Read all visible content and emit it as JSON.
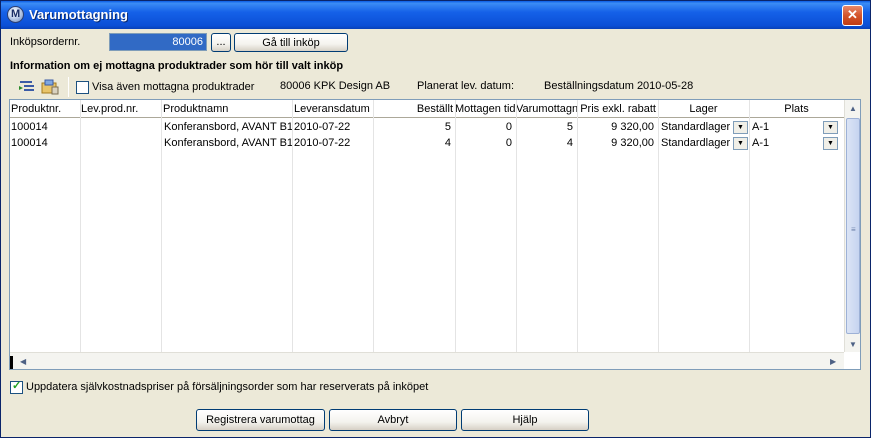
{
  "window": {
    "title": "Varumottagning",
    "close": "✕"
  },
  "po": {
    "label": "Inköpsordernr.",
    "value": "80006",
    "browse_label": "...",
    "goto_label": "Gå till inköp"
  },
  "section": {
    "title": "Information om ej mottagna produktrader som hör till valt inköp"
  },
  "toolbar": {
    "show_received_label": "Visa även mottagna produktrader",
    "supplier": "80006 KPK Design AB",
    "planned_label": "Planerat lev. datum:",
    "order_date": "Beställningsdatum 2010-05-28"
  },
  "grid": {
    "headers": [
      "Produktnr.",
      "Lev.prod.nr.",
      "Produktnamn",
      "Leveransdatum",
      "Beställt",
      "Mottagen tidi",
      "Varumottagn",
      "Pris exkl. rabatt",
      "Lager",
      "Plats"
    ],
    "rows": [
      [
        "100014",
        "",
        "Konferansbord, AVANT B1",
        "2010-07-22",
        "5",
        "0",
        "5",
        "9 320,00",
        "Standardlager",
        "A-1"
      ],
      [
        "100014",
        "",
        "Konferansbord, AVANT B1",
        "2010-07-22",
        "4",
        "0",
        "4",
        "9 320,00",
        "Standardlager",
        "A-1"
      ]
    ]
  },
  "footer": {
    "update_cost_label": "Uppdatera självkostnadspriser på försäljningsorder som har reserverats på inköpet",
    "register_label": "Registrera varumottag",
    "cancel_label": "Avbryt",
    "help_label": "Hjälp"
  },
  "colors": {
    "title_bar": "#0b4fd6",
    "selection": "#316ac5",
    "face": "#ece9d8"
  }
}
